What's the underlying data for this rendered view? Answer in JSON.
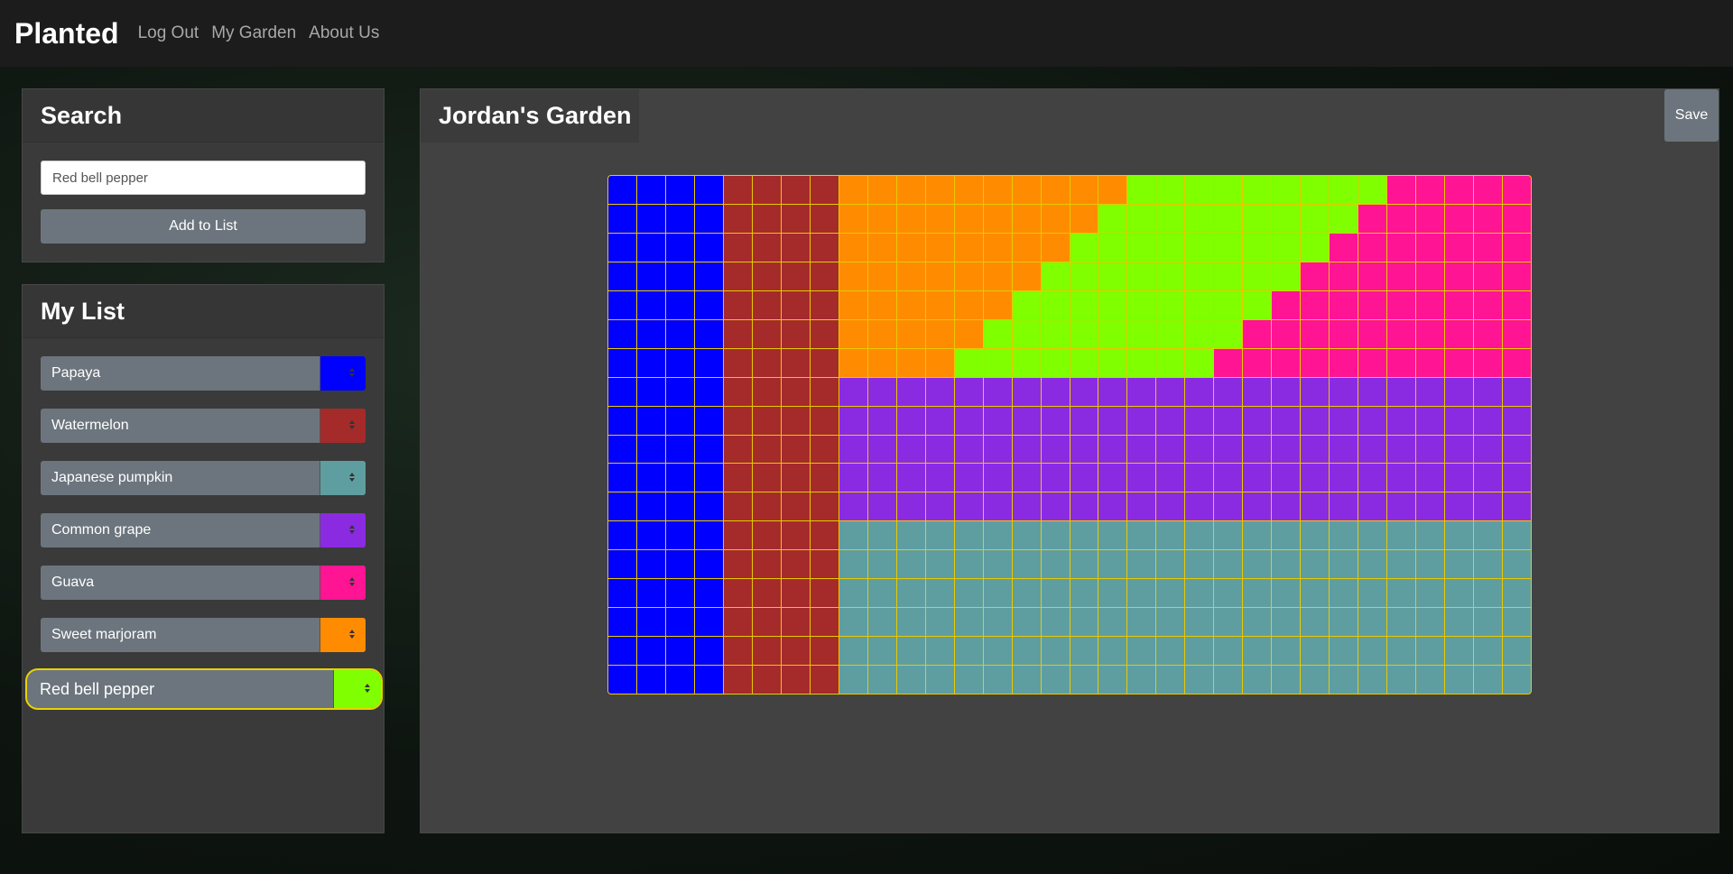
{
  "navbar": {
    "brand": "Planted",
    "links": [
      "Log Out",
      "My Garden",
      "About Us"
    ]
  },
  "search": {
    "title": "Search",
    "input_value": "Red bell pepper",
    "add_label": "Add to List"
  },
  "my_list": {
    "title": "My List",
    "items": [
      {
        "label": "Papaya",
        "color": "#0000ff"
      },
      {
        "label": "Watermelon",
        "color": "#a52a2a"
      },
      {
        "label": "Japanese pumpkin",
        "color": "#5f9ea0"
      },
      {
        "label": "Common grape",
        "color": "#8a2be2"
      },
      {
        "label": "Guava",
        "color": "#ff1493"
      },
      {
        "label": "Sweet marjoram",
        "color": "#ff8c00"
      },
      {
        "label": "Red bell pepper",
        "color": "#7fff00"
      }
    ],
    "active_index": 6
  },
  "garden": {
    "title": "Jordan's Garden",
    "save_label": "Save",
    "cols": 32,
    "rows": 18,
    "grid_line_color": "#e8c900",
    "legend": {
      "P": "#0000ff",
      "W": "#a52a2a",
      "J": "#5f9ea0",
      "C": "#8a2be2",
      "G": "#ff1493",
      "S": "#ff8c00",
      "R": "#7fff00"
    },
    "layout": [
      "PPPPWWWWSSSSSSSSSSRRRRRRRRRGGGGG",
      "PPPPWWWWSSSSSSSSSRRRRRRRRRGGGGGG",
      "PPPPWWWWSSSSSSSSRRRRRRRRRGGGGGGG",
      "PPPPWWWWSSSSSSSRRRRRRRRRGGGGGGGG",
      "PPPPWWWWSSSSSSRRRRRRRRRGGGGGGGGG",
      "PPPPWWWWSSSSSRRRRRRRRRGGGGGGGGGG",
      "PPPPWWWWSSSSRRRRRRRRRGGGGGGGGGGG",
      "PPPPWWWWCCCCCCCCCCCCCCCCCCCCCCCC",
      "PPPPWWWWCCCCCCCCCCCCCCCCCCCCCCCC",
      "PPPPWWWWCCCCCCCCCCCCCCCCCCCCCCCC",
      "PPPPWWWWCCCCCCCCCCCCCCCCCCCCCCCC",
      "PPPPWWWWCCCCCCCCCCCCCCCCCCCCCCCC",
      "PPPPWWWWJJJJJJJJJJJJJJJJJJJJJJJJ",
      "PPPPWWWWJJJJJJJJJJJJJJJJJJJJJJJJ",
      "PPPPWWWWJJJJJJJJJJJJJJJJJJJJJJJJ",
      "PPPPWWWWJJJJJJJJJJJJJJJJJJJJJJJJ",
      "PPPPWWWWJJJJJJJJJJJJJJJJJJJJJJJJ",
      "PPPPWWWWJJJJJJJJJJJJJJJJJJJJJJJJ"
    ]
  }
}
